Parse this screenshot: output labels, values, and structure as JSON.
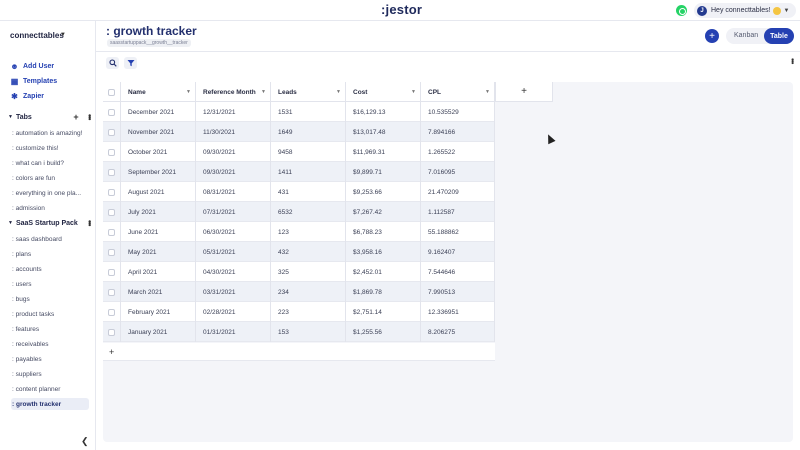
{
  "app": {
    "logo": ":jestor",
    "user_initial": "J",
    "user_greeting": "Hey connecttables!"
  },
  "sidebar": {
    "workspace": "connecttables",
    "links": [
      {
        "label": "Add User",
        "icon": "add-user-icon"
      },
      {
        "label": "Templates",
        "icon": "templates-icon"
      },
      {
        "label": "Zapier",
        "icon": "zapier-icon"
      }
    ],
    "tabs_section": {
      "title": "Tabs",
      "items": [
        ": automation is amazing!",
        ": customize this!",
        ": what can i build?",
        ": colors are fun",
        ": everything in one pla...",
        ": admission"
      ]
    },
    "pack_section": {
      "title": "SaaS Startup Pack",
      "items": [
        ": saas dashboard",
        ": plans",
        ": accounts",
        ": users",
        ": bugs",
        ": product tasks",
        ": features",
        ": receivables",
        ": payables",
        ": suppliers",
        ": content planner",
        ": growth tracker"
      ],
      "active_index": 11
    }
  },
  "header": {
    "title": ": growth tracker",
    "subtitle": "saasstartuppack__growth__tracker",
    "view_kanban": "Kanban",
    "view_table": "Table"
  },
  "table": {
    "columns": [
      "Name",
      "Reference Month",
      "Leads",
      "Cost",
      "CPL"
    ],
    "rows": [
      [
        "December 2021",
        "12/31/2021",
        "1531",
        "$16,129.13",
        "10.535529"
      ],
      [
        "November 2021",
        "11/30/2021",
        "1649",
        "$13,017.48",
        "7.894166"
      ],
      [
        "October 2021",
        "09/30/2021",
        "9458",
        "$11,969.31",
        "1.265522"
      ],
      [
        "September 2021",
        "09/30/2021",
        "1411",
        "$9,899.71",
        "7.016095"
      ],
      [
        "August 2021",
        "08/31/2021",
        "431",
        "$9,253.66",
        "21.470209"
      ],
      [
        "July 2021",
        "07/31/2021",
        "6532",
        "$7,267.42",
        "1.112587"
      ],
      [
        "June 2021",
        "06/30/2021",
        "123",
        "$6,788.23",
        "55.188862"
      ],
      [
        "May 2021",
        "05/31/2021",
        "432",
        "$3,958.16",
        "9.162407"
      ],
      [
        "April 2021",
        "04/30/2021",
        "325",
        "$2,452.01",
        "7.544646"
      ],
      [
        "March 2021",
        "03/31/2021",
        "234",
        "$1,869.78",
        "7.990513"
      ],
      [
        "February 2021",
        "02/28/2021",
        "223",
        "$2,751.14",
        "12.336951"
      ],
      [
        "January 2021",
        "01/31/2021",
        "153",
        "$1,255.56",
        "8.206275"
      ]
    ]
  },
  "colors": {
    "accent": "#2541b2",
    "title": "#23306e",
    "row_alt": "#eef1f7"
  }
}
